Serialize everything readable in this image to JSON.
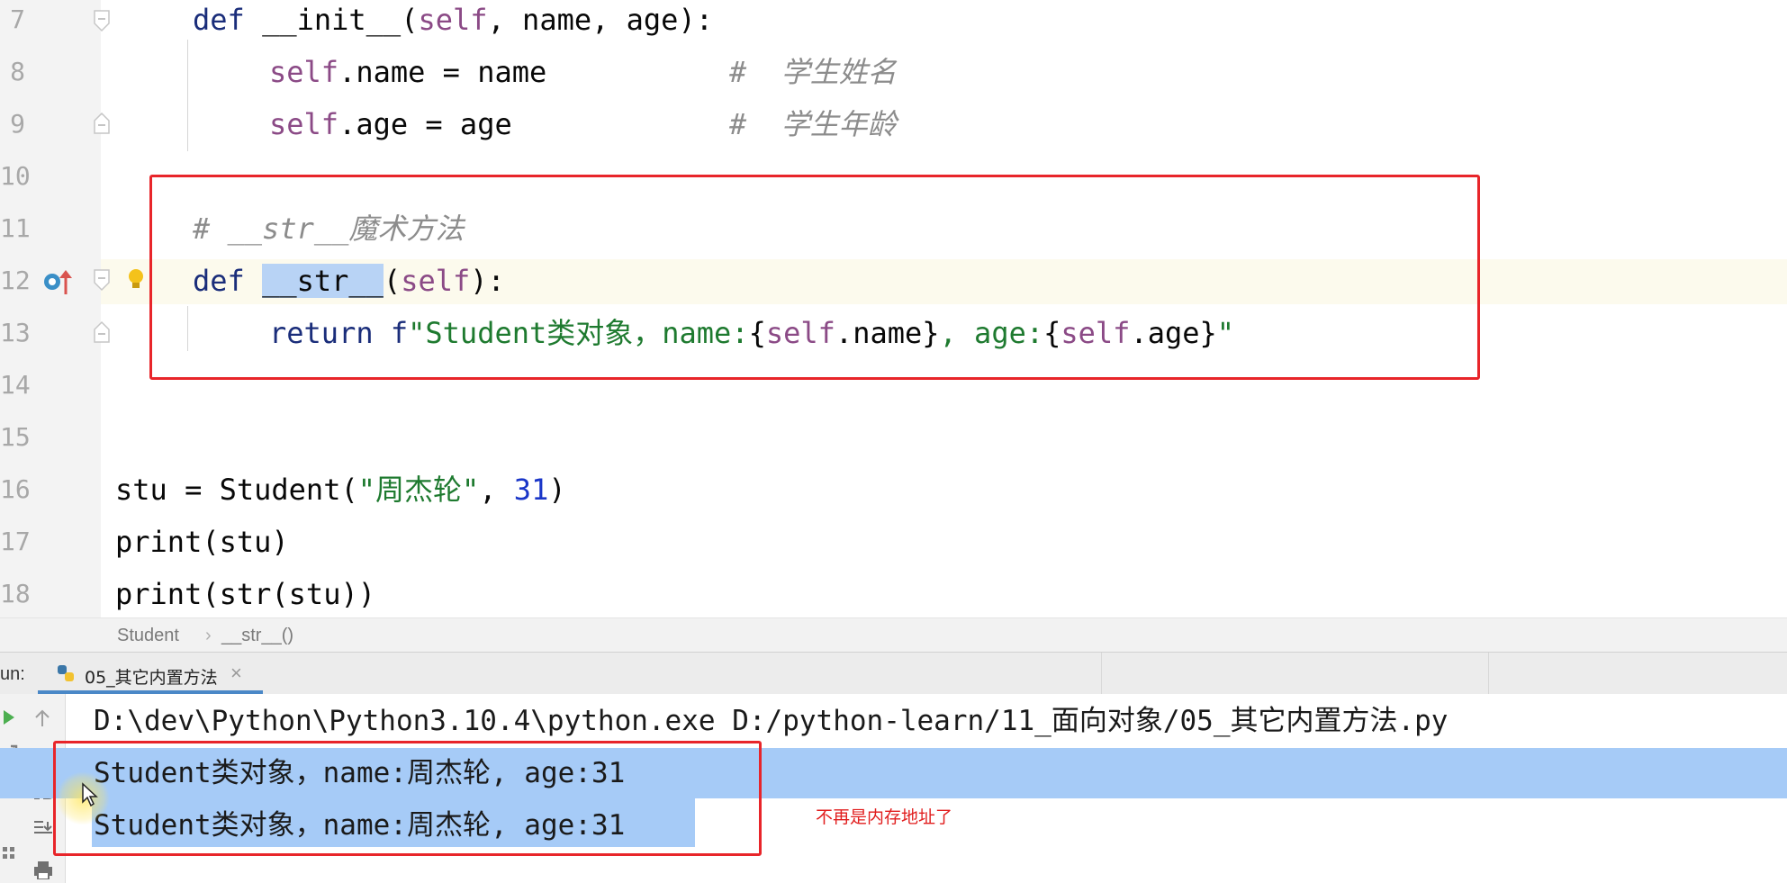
{
  "editor": {
    "line_numbers": [
      "7",
      "8",
      "9",
      "10",
      "11",
      "12",
      "13",
      "14",
      "15",
      "16",
      "17",
      "18"
    ],
    "lines": {
      "l7": {
        "kw": "def ",
        "fn": "__init__",
        "p1": "(",
        "self": "self",
        "rest": ", name, age):"
      },
      "l8": {
        "self": "self",
        "rest": ".name = name",
        "comment": "#  学生姓名"
      },
      "l9": {
        "self": "self",
        "rest": ".age = age",
        "comment": "#  学生年龄"
      },
      "l11": {
        "comment": "# __str__魔术方法"
      },
      "l12": {
        "kw": "def ",
        "fn": "__str__",
        "p1": "(",
        "self": "self",
        "rest": "):"
      },
      "l13": {
        "kw": "return ",
        "f": "f",
        "s1": "\"Student类对象，name:",
        "b1": "{",
        "self1": "self",
        "n1": ".name",
        "b2": "}",
        "s2": ", age:",
        "b3": "{",
        "self2": "self",
        "n2": ".age",
        "b4": "}",
        "s3": "\""
      },
      "l16": {
        "a": "stu = Student(",
        "s": "\"周杰轮\"",
        "c": ", ",
        "n": "31",
        "e": ")"
      },
      "l17": {
        "a": "print(stu)"
      },
      "l18": {
        "a": "print(str(stu))"
      }
    }
  },
  "breadcrumb": {
    "items": [
      "Student",
      "__str__()"
    ]
  },
  "run": {
    "label": "un:",
    "tab": "05_其它内置方法",
    "close": "×"
  },
  "console": {
    "command": "D:\\dev\\Python\\Python3.10.4\\python.exe D:/python-learn/11_面向对象/05_其它内置方法.py",
    "output": [
      "Student类对象，name:周杰轮, age:31",
      "Student类对象，name:周杰轮, age:31"
    ],
    "note": "不再是内存地址了"
  },
  "colors": {
    "keyword": "#1a2d7a",
    "self": "#8b4a86",
    "string": "#1e7a2f",
    "number": "#1a36c8",
    "comment": "#8c8c8c",
    "annotation": "#e8252a",
    "selection": "#a6cbf7"
  }
}
